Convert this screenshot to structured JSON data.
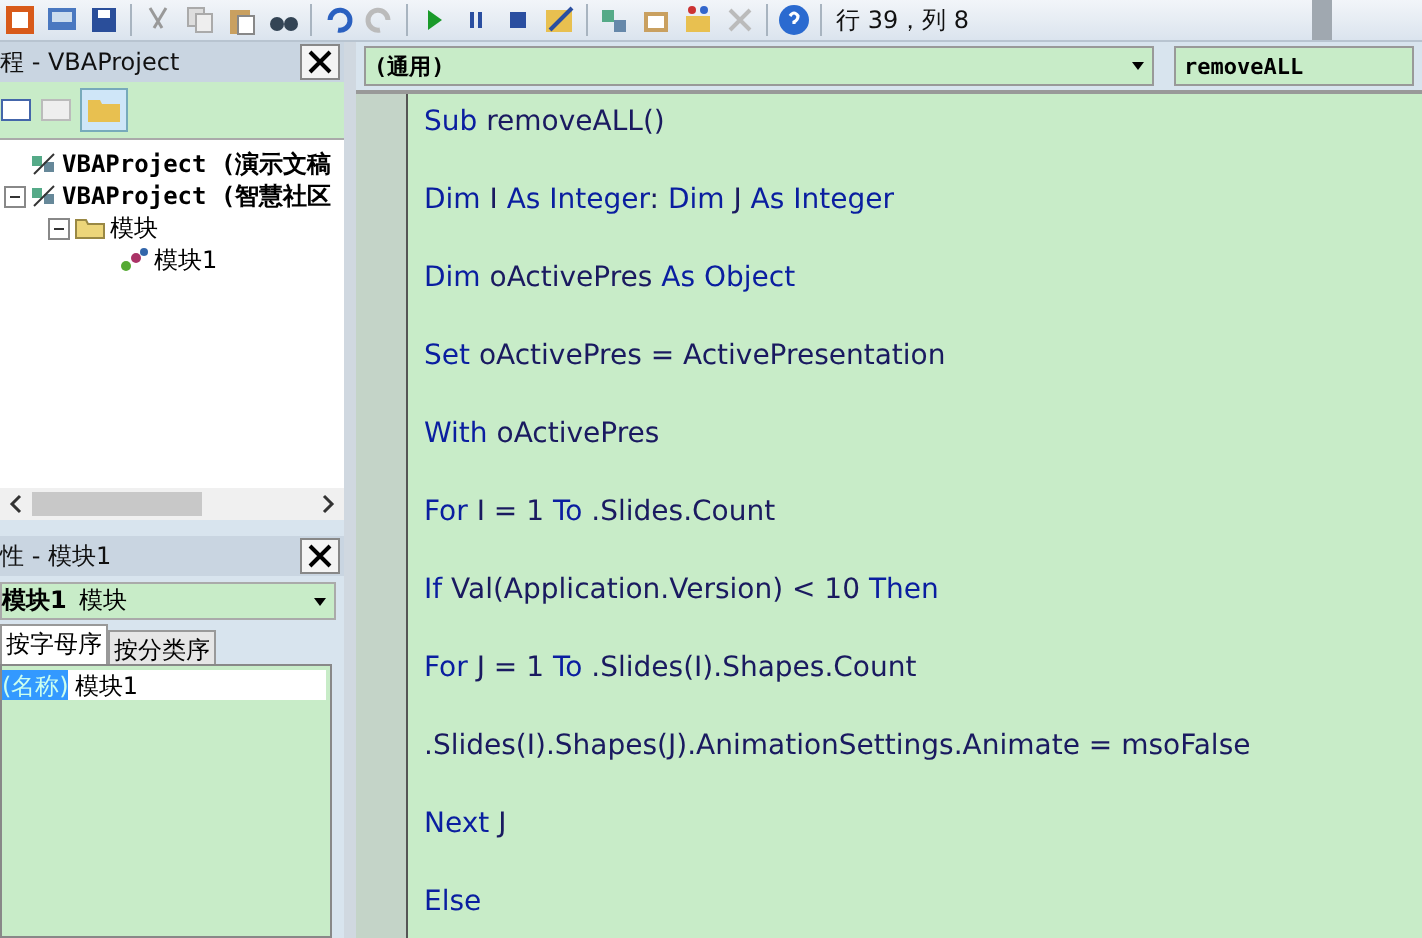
{
  "toolbar": {
    "position": "行 39，列 8"
  },
  "project_panel": {
    "title": "程 - VBAProject",
    "tree": [
      {
        "label": "VBAProject (演示文稿",
        "kind": "project"
      },
      {
        "label": "VBAProject (智慧社区",
        "expanded": true,
        "kind": "project",
        "children": [
          {
            "label": "模块",
            "expanded": true,
            "kind": "folder",
            "children": [
              {
                "label": "模块1",
                "kind": "module"
              }
            ]
          }
        ]
      }
    ]
  },
  "properties_panel": {
    "title": "性 - 模块1",
    "object": {
      "name": "模块1",
      "type": "模块"
    },
    "tabs": [
      {
        "label": "按字母序",
        "selected": true
      },
      {
        "label": "按分类序",
        "selected": false
      }
    ],
    "rows": [
      {
        "name": "(名称)",
        "value": "模块1",
        "selected": true
      }
    ]
  },
  "code_window": {
    "object_combo": "(通用)",
    "procedure_combo": "removeALL",
    "lines": [
      [
        {
          "text": "Sub",
          "kind": "keyword"
        },
        {
          "text": " removeALL()",
          "kind": "plain"
        }
      ],
      [
        {
          "text": "Dim",
          "kind": "keyword"
        },
        {
          "text": " I ",
          "kind": "plain"
        },
        {
          "text": "As Integer",
          "kind": "keyword"
        },
        {
          "text": ": ",
          "kind": "plain"
        },
        {
          "text": "Dim",
          "kind": "keyword"
        },
        {
          "text": " J ",
          "kind": "plain"
        },
        {
          "text": "As Integer",
          "kind": "keyword"
        }
      ],
      [
        {
          "text": "Dim",
          "kind": "keyword"
        },
        {
          "text": " oActivePres ",
          "kind": "plain"
        },
        {
          "text": "As Object",
          "kind": "keyword"
        }
      ],
      [
        {
          "text": "Set",
          "kind": "keyword"
        },
        {
          "text": " oActivePres = ActivePresentation",
          "kind": "plain"
        }
      ],
      [
        {
          "text": "With",
          "kind": "keyword"
        },
        {
          "text": " oActivePres",
          "kind": "plain"
        }
      ],
      [
        {
          "text": "For",
          "kind": "keyword"
        },
        {
          "text": " I = 1 ",
          "kind": "plain"
        },
        {
          "text": "To",
          "kind": "keyword"
        },
        {
          "text": " .Slides.Count",
          "kind": "plain"
        }
      ],
      [
        {
          "text": "If",
          "kind": "keyword"
        },
        {
          "text": " Val(Application.Version) < 10 ",
          "kind": "plain"
        },
        {
          "text": "Then",
          "kind": "keyword"
        }
      ],
      [
        {
          "text": "For",
          "kind": "keyword"
        },
        {
          "text": " J = 1 ",
          "kind": "plain"
        },
        {
          "text": "To",
          "kind": "keyword"
        },
        {
          "text": " .Slides(I).Shapes.Count",
          "kind": "plain"
        }
      ],
      [
        {
          "text": ".Slides(I).Shapes(J).AnimationSettings.Animate = msoFalse",
          "kind": "plain"
        }
      ],
      [
        {
          "text": "Next",
          "kind": "keyword"
        },
        {
          "text": " J",
          "kind": "plain"
        }
      ],
      [
        {
          "text": "Else",
          "kind": "keyword"
        }
      ]
    ]
  }
}
